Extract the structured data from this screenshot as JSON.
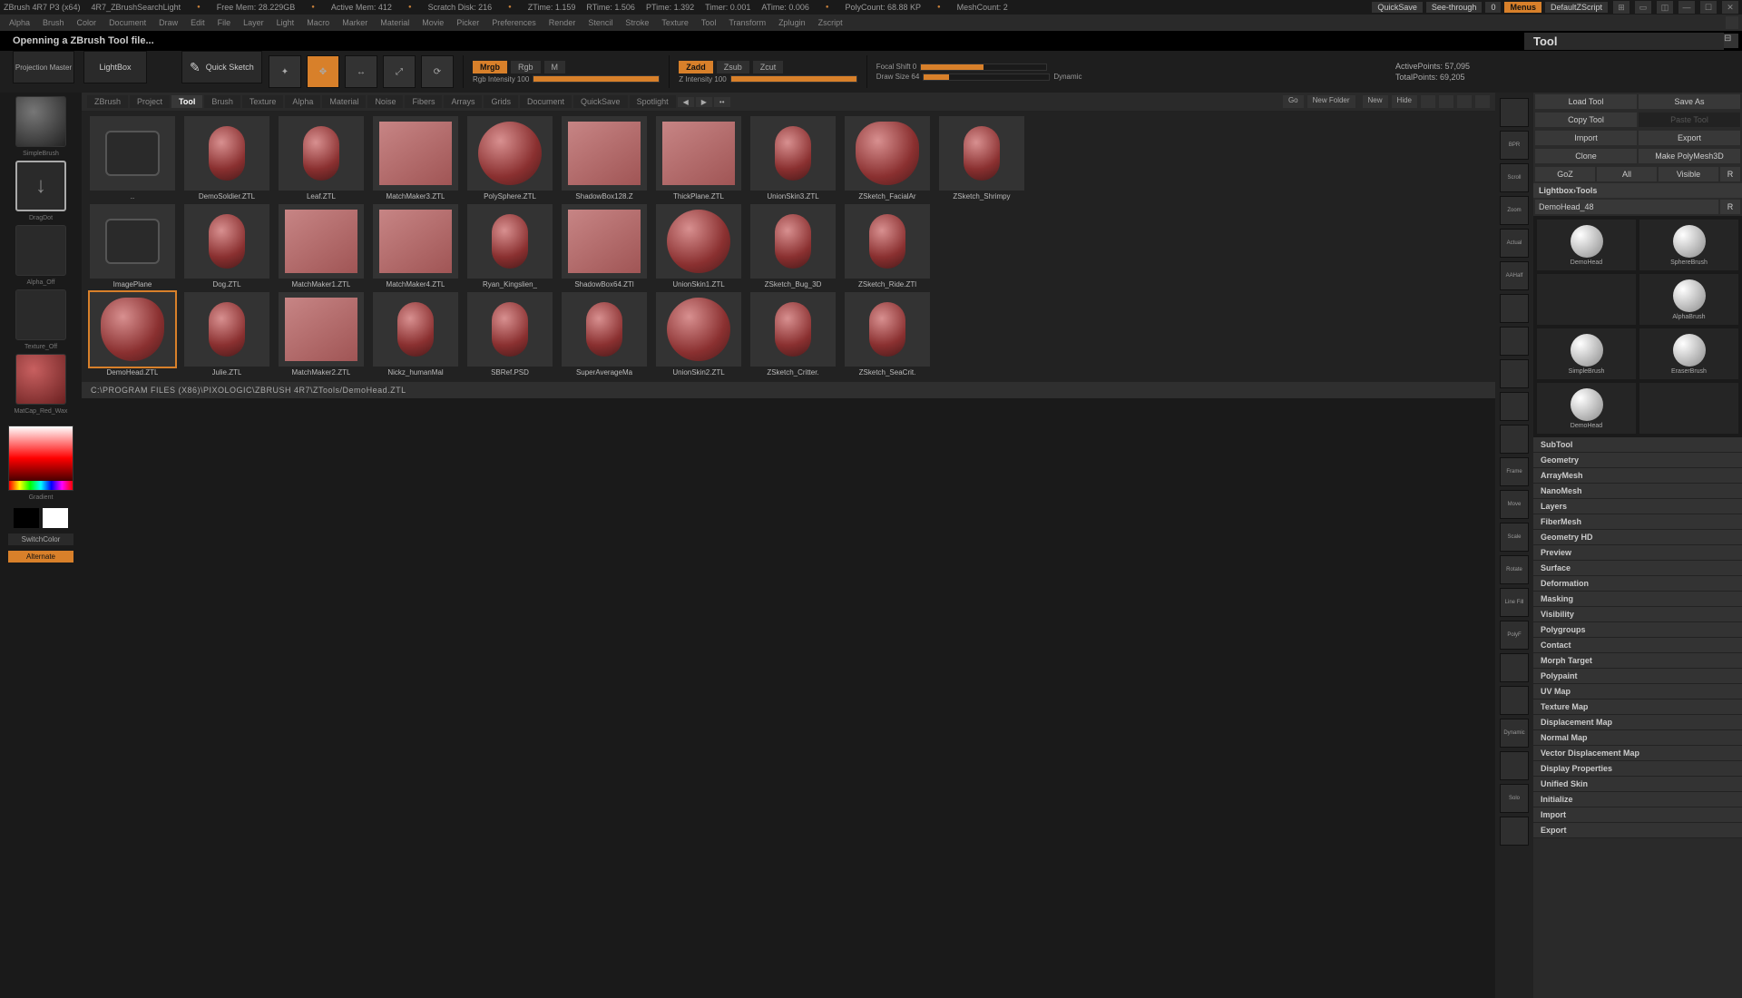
{
  "topinfo": {
    "segments": [
      "ZBrush 4R7 P3 (x64)",
      "4R7_ZBrushSearchLight",
      "Free Mem: 28.229GB",
      "Active Mem: 412",
      "Scratch Disk: 216",
      "ZTime: 1.159",
      "RTime: 1.506",
      "PTime: 1.392",
      "Timer: 0.001",
      "ATime: 0.006",
      "PolyCount: 68.88 KP",
      "MeshCount: 2"
    ],
    "quicksave": "QuickSave",
    "seethrough": "See-through",
    "seethrough_val": "0",
    "menus": "Menus",
    "script": "DefaultZScript"
  },
  "menubar": [
    "Alpha",
    "Brush",
    "Color",
    "Document",
    "Draw",
    "Edit",
    "File",
    "Layer",
    "Light",
    "Macro",
    "Marker",
    "Material",
    "Movie",
    "Picker",
    "Preferences",
    "Render",
    "Stencil",
    "Stroke",
    "Texture",
    "Tool",
    "Transform",
    "Zplugin",
    "Zscript"
  ],
  "status_line": "Openning a ZBrush Tool file...",
  "tool_panel_title": "Tool",
  "projection_master": "Projection\nMaster",
  "lightbox": "LightBox",
  "quick_sketch": "Quick\nSketch",
  "shelf": {
    "modes": [
      "Mrgb",
      "Rgb",
      "M"
    ],
    "zmodes": [
      "Zadd",
      "Zsub",
      "Zcut"
    ],
    "rgb_label": "Rgb Intensity 100",
    "z_label": "Z Intensity 100",
    "focal": "Focal Shift 0",
    "drawsize": "Draw Size 64",
    "dynamic": "Dynamic",
    "active_pts": "ActivePoints: 57,095",
    "total_pts": "TotalPoints: 69,205"
  },
  "lb_tabs": [
    "ZBrush",
    "Project",
    "Tool",
    "Brush",
    "Texture",
    "Alpha",
    "Material",
    "Noise",
    "Fibers",
    "Arrays",
    "Grids",
    "Document",
    "QuickSave",
    "Spotlight"
  ],
  "lb_active_tab": "Tool",
  "lb_right": {
    "go": "Go",
    "new_folder": "New Folder",
    "new": "New",
    "hide": "Hide"
  },
  "thumbs": [
    {
      "label": "..",
      "type": "folder"
    },
    {
      "label": "DemoSoldier.ZTL",
      "type": "figure"
    },
    {
      "label": "Leaf.ZTL",
      "type": "leaf"
    },
    {
      "label": "MatchMaker3.ZTL",
      "type": "plane"
    },
    {
      "label": "PolySphere.ZTL",
      "type": "sphere"
    },
    {
      "label": "ShadowBox128.Z",
      "type": "cube"
    },
    {
      "label": "ThickPlane.ZTL",
      "type": "plane"
    },
    {
      "label": "UnionSkin3.ZTL",
      "type": "blob"
    },
    {
      "label": "ZSketch_FacialAr",
      "type": "head"
    },
    {
      "label": "ZSketch_Shrimpy",
      "type": "shrimp"
    },
    {
      "label": "ImagePlane",
      "type": "folder"
    },
    {
      "label": "Dog.ZTL",
      "type": "figure"
    },
    {
      "label": "MatchMaker1.ZTL",
      "type": "plane"
    },
    {
      "label": "MatchMaker4.ZTL",
      "type": "plane"
    },
    {
      "label": "Ryan_Kingslien_",
      "type": "figure"
    },
    {
      "label": "ShadowBox64.ZTl",
      "type": "cube"
    },
    {
      "label": "UnionSkin1.ZTL",
      "type": "sphere"
    },
    {
      "label": "ZSketch_Bug_3D",
      "type": "bug"
    },
    {
      "label": "ZSketch_Ride.ZTl",
      "type": "ride"
    },
    {
      "label": "",
      "type": "empty"
    },
    {
      "label": "DemoHead.ZTL",
      "type": "head",
      "selected": true
    },
    {
      "label": "Julie.ZTL",
      "type": "figure"
    },
    {
      "label": "MatchMaker2.ZTL",
      "type": "plane"
    },
    {
      "label": "Nickz_humanMal",
      "type": "figure"
    },
    {
      "label": "SBRef.PSD",
      "type": "ref"
    },
    {
      "label": "SuperAverageMa",
      "type": "figure"
    },
    {
      "label": "UnionSkin2.ZTL",
      "type": "sphere"
    },
    {
      "label": "ZSketch_Critter.",
      "type": "critter"
    },
    {
      "label": "ZSketch_SeaCrit.",
      "type": "sea"
    },
    {
      "label": "",
      "type": "empty"
    }
  ],
  "pathbar": "C:\\PROGRAM FILES (X86)\\PIXOLOGIC\\ZBRUSH 4R7\\ZTools/DemoHead.ZTL",
  "left": {
    "alpha_off": "Alpha_Off",
    "texture_off": "Texture_Off",
    "matcap": "MatCap_Red_Wax",
    "gradient": "Gradient",
    "switchcolor": "SwitchColor",
    "alternate": "Alternate",
    "simplebrush": "SimpleBrush",
    "dragdot": "DragDot"
  },
  "rightrail": [
    "",
    "BPR",
    "Scroll",
    "Zoom",
    "Actual",
    "AAHalf",
    "",
    "",
    "",
    "",
    "",
    "Frame",
    "Move",
    "Scale",
    "Rotate",
    "Line Fill",
    "PolyF",
    "",
    "",
    "Dynamic",
    "",
    "Solo",
    ""
  ],
  "toolpanel": {
    "buttons": [
      [
        "Load Tool",
        "Save As"
      ],
      [
        "Copy Tool",
        "Paste Tool"
      ],
      [
        "Import",
        "Export"
      ],
      [
        "Clone",
        "Make PolyMesh3D"
      ],
      [
        "GoZ",
        "All",
        "Visible",
        "R"
      ]
    ],
    "lightbox_tools": "Lightbox›Tools",
    "active_tool": "DemoHead_48",
    "active_tool_r": "R",
    "brushes": [
      "DemoHead",
      "SphereBrush",
      "",
      "AlphaBrush",
      "SimpleBrush",
      "EraserBrush",
      "DemoHead",
      ""
    ],
    "sections": [
      "SubTool",
      "Geometry",
      "ArrayMesh",
      "NanoMesh",
      "Layers",
      "FiberMesh",
      "Geometry HD",
      "Preview",
      "Surface",
      "Deformation",
      "Masking",
      "Visibility",
      "Polygroups",
      "Contact",
      "Morph Target",
      "Polypaint",
      "UV Map",
      "Texture Map",
      "Displacement Map",
      "Normal Map",
      "Vector Displacement Map",
      "Display Properties",
      "Unified Skin",
      "Initialize",
      "Import",
      "Export"
    ]
  }
}
